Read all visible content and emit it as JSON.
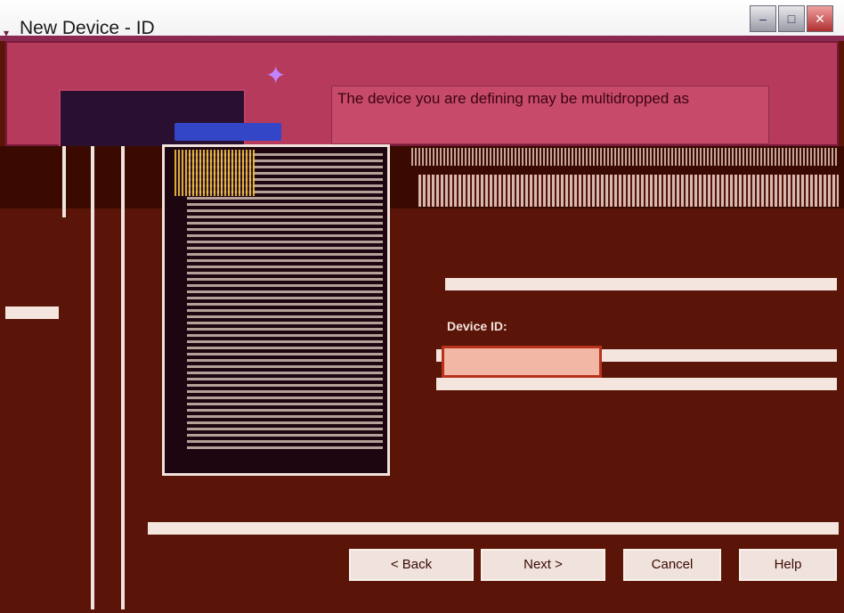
{
  "window": {
    "title": "New Device - ID",
    "buttons": {
      "minimize": "–",
      "maximize": "□",
      "close": "✕"
    }
  },
  "message": {
    "text": "The device you are defining may be multidropped as"
  },
  "id_field": {
    "label": "Device ID:",
    "value": ""
  },
  "footer": {
    "back_label": "< Back",
    "next_label": "Next >",
    "cancel_label": "Cancel",
    "help_label": "Help"
  },
  "icons": {
    "app": "device-icon",
    "wizard": "wizard-icon"
  },
  "colors": {
    "background": "#5a1508",
    "title_accent": "#8a2a52",
    "message_bg": "#c84a6b",
    "field_border": "#b8321c"
  }
}
